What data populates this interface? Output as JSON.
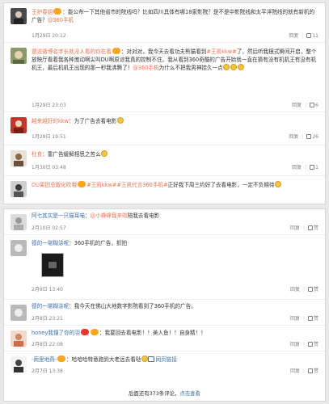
{
  "card1": {
    "comments": [
      {
        "user": "王护春姐",
        "text_before": "：能公布一下其他省市的院线吗？比如四川具体有哪18家影院？是不是中影院线和太平洋院线的就有新机的广告？",
        "mention": "@360手机",
        "date": "1月29日 20:12",
        "reply": "回复",
        "likes": "11"
      },
      {
        "user": "遗说微博名字长就没人看的你在看",
        "text_1": "：对对对，我今天去看功夫熊猫看到",
        "tag_1": "#王凯kkw#",
        "text_2": "了，然后听我模式瞬间开启，整个放映厅看着我各种激动啊尖叫DU啊原谅我真的控制不住。我从看到360奇酷的广告开始就一直在猜有没有机机王有没有机机王，最后机机王出现的那一秒我沸腾了！",
        "mention": "@360手机",
        "text_3": "为什么不把我男神挂久一点",
        "date": "1月29日 23:03",
        "reply": "回复",
        "likes": "6"
      },
      {
        "user": "越来越好的kkw",
        "text": "：为了广告去看电影",
        "date": "1月29日 19:51",
        "reply": "回复",
        "likes": "26"
      },
      {
        "user": "杜食",
        "text": "：靠广告缓解相思之苦么",
        "date": "1月30日 03:48",
        "reply": "回复",
        "likes": "1"
      },
      {
        "user": "DU果团总裁化吹哦",
        "tag_1": "#王凯kkw#",
        "tag_2": "#王凯代言360手机#",
        "text": "正好我下周三约好了去看电影，一定不负期待",
        "date": "",
        "reply": "",
        "likes": ""
      }
    ]
  },
  "card2": {
    "comments": [
      {
        "user": "阿七其实是一只猫耳喵",
        "mention": "@小峰峰我来啦",
        "text": "陪我去看电影",
        "date": "2月10日 02:57",
        "reply": "回复",
        "likes": "赞"
      },
      {
        "user": "德的一堪糊涂呢",
        "text": "：360手机的广告，抓拍",
        "date": "2月9日 13:40",
        "reply": "回复",
        "likes": "赞",
        "picture_icon": "photo-icon"
      },
      {
        "user": "德的一堪糊涂呢",
        "text": "：我今天在佛山大地数字影院看到了360手机的广告。",
        "date": "2月8日 23:21",
        "reply": "回复",
        "likes": "赞"
      },
      {
        "user": "honey我懂了你的羽",
        "text": "：我要回去看电影！！美人鱼！！自身精！！",
        "date": "2月8日 22:08",
        "reply": "回复",
        "likes": "赞"
      },
      {
        "user": "-雨里地燕-",
        "text": "：哈哈哈特意跑到大老远去看哒",
        "link_text": "网页链接",
        "date": "2月7日 13:38",
        "reply": "回复",
        "likes": "赞"
      }
    ],
    "footer_prefix": "后面还有373条评论，",
    "footer_link": "点击查看"
  },
  "colors": {
    "accent_orange": "#eb7350",
    "link_blue": "#3e6ea7",
    "meta_gray": "#808080"
  }
}
